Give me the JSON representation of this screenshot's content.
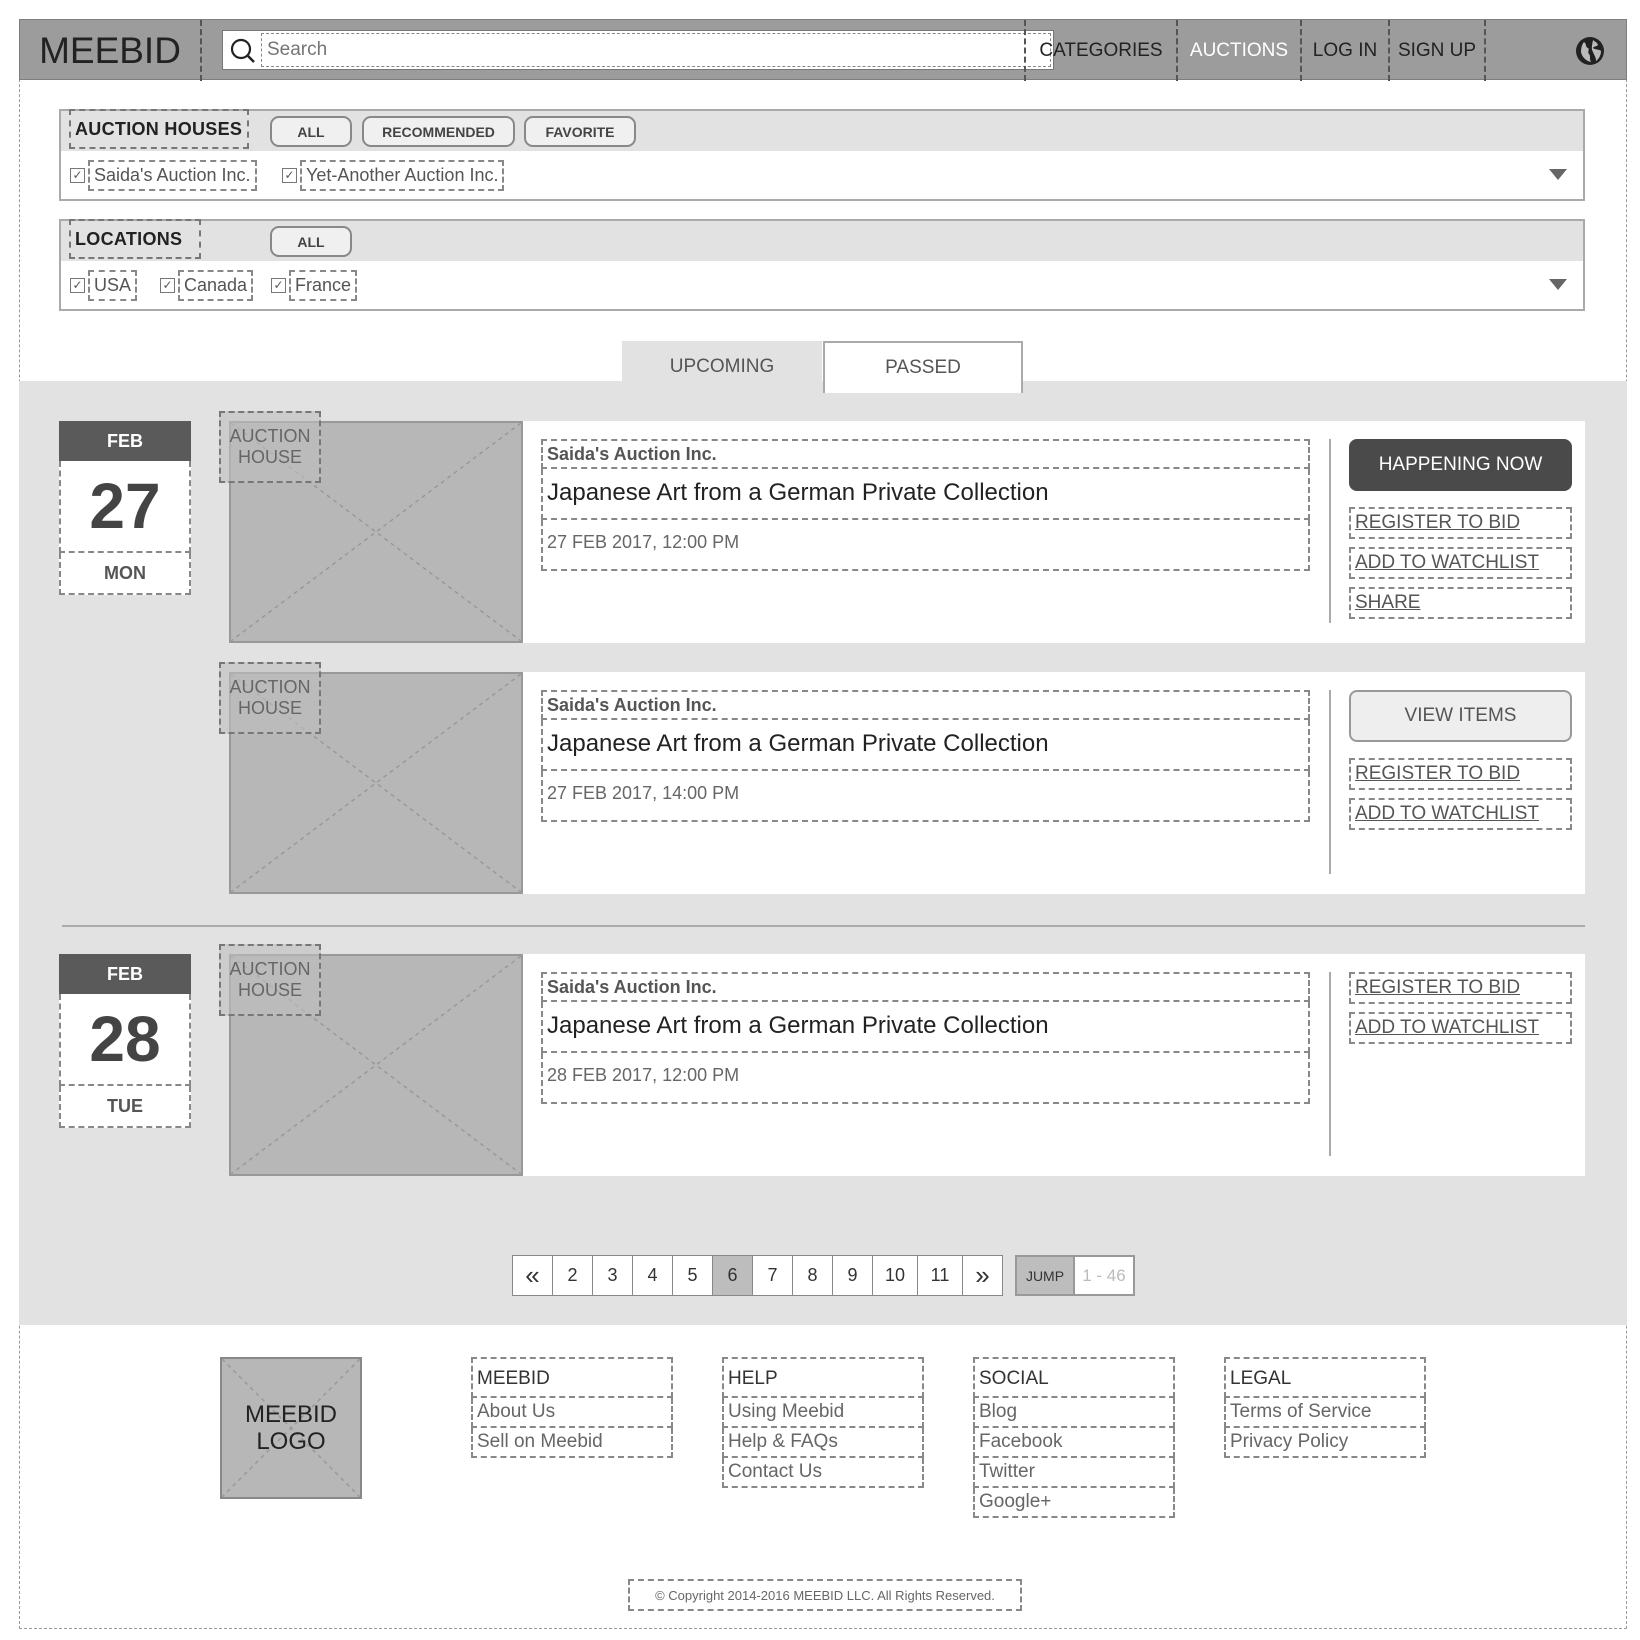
{
  "header": {
    "logo": "MEEBID",
    "search_placeholder": "Search",
    "nav": [
      "CATEGORIES",
      "AUCTIONS",
      "LOG IN",
      "SIGN UP"
    ],
    "active_nav": "AUCTIONS"
  },
  "filters": {
    "auction_houses": {
      "title": "AUCTION HOUSES",
      "buttons": [
        "ALL",
        "RECOMMENDED",
        "FAVORITE"
      ],
      "options": [
        "Saida's Auction Inc.",
        "Yet-Another Auction Inc."
      ]
    },
    "locations": {
      "title": "LOCATIONS",
      "buttons": [
        "ALL"
      ],
      "options": [
        "USA",
        "Canada",
        "France"
      ]
    }
  },
  "tabs": [
    "UPCOMING",
    "PASSED"
  ],
  "days": [
    {
      "month": "FEB",
      "day": "27",
      "weekday": "MON"
    },
    {
      "month": "FEB",
      "day": "28",
      "weekday": "TUE"
    }
  ],
  "auctions": [
    {
      "badge": "AUCTION HOUSE",
      "house": "Saida's Auction Inc.",
      "title": "Japanese Art from a German Private Collection",
      "when": "27 FEB 2017, 12:00 PM",
      "primary": "HAPPENING NOW",
      "links": [
        "REGISTER TO BID",
        "ADD TO WATCHLIST",
        "SHARE"
      ]
    },
    {
      "badge": "AUCTION HOUSE",
      "house": "Saida's Auction Inc.",
      "title": "Japanese Art from a German Private Collection",
      "when": "27 FEB 2017, 14:00 PM",
      "primary": "VIEW ITEMS",
      "links": [
        "REGISTER TO BID",
        "ADD TO WATCHLIST"
      ]
    },
    {
      "badge": "AUCTION HOUSE",
      "house": "Saida's Auction Inc.",
      "title": "Japanese Art from a German Private Collection",
      "when": "28 FEB 2017, 12:00 PM",
      "links": [
        "REGISTER TO BID",
        "ADD TO WATCHLIST"
      ]
    }
  ],
  "pagination": {
    "prev": "«",
    "pages": [
      "2",
      "3",
      "4",
      "5",
      "6",
      "7",
      "8",
      "9",
      "10",
      "11"
    ],
    "current": "6",
    "next": "»",
    "jump_label": "JUMP",
    "jump_placeholder": "1 - 46"
  },
  "footer": {
    "logo": "MEEBID LOGO",
    "columns": [
      {
        "heading": "MEEBID",
        "items": [
          "About Us",
          "Sell on Meebid"
        ]
      },
      {
        "heading": "HELP",
        "items": [
          "Using Meebid",
          "Help & FAQs",
          "Contact Us"
        ]
      },
      {
        "heading": "SOCIAL",
        "items": [
          "Blog",
          "Facebook",
          "Twitter",
          "Google+"
        ]
      },
      {
        "heading": "LEGAL",
        "items": [
          "Terms of Service",
          "Privacy Policy"
        ]
      }
    ],
    "copyright": "© Copyright 2014-2016 MEEBID LLC. All Rights Reserved."
  }
}
